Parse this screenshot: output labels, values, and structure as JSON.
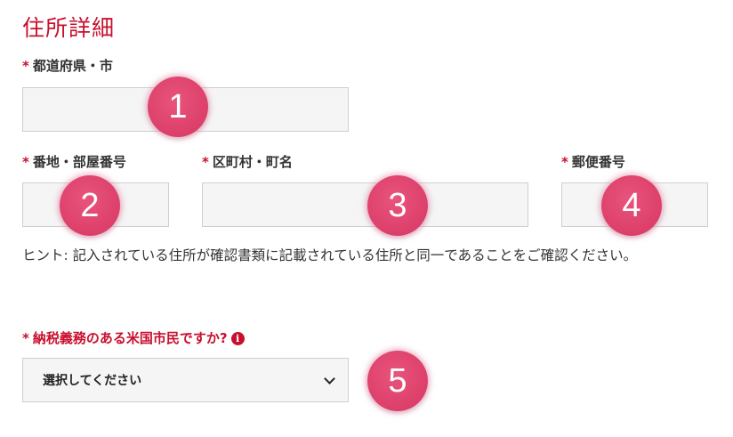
{
  "section_title": "住所詳細",
  "required_mark": "*",
  "fields": {
    "prefecture_city": {
      "label": "都道府県・市",
      "value": ""
    },
    "street_room": {
      "label": "番地・部屋番号",
      "value": ""
    },
    "ward_town": {
      "label": "区町村・町名",
      "value": ""
    },
    "postal_code": {
      "label": "郵便番号",
      "value": ""
    }
  },
  "hint": "ヒント: 記入されている住所が確認書類に記載されている住所と同一であることをご確認ください。",
  "tax_question": {
    "label": "納税義務のある米国市民ですか?",
    "info_icon": "i",
    "selected": "選択してください"
  },
  "badges": [
    "1",
    "2",
    "3",
    "4",
    "5"
  ],
  "colors": {
    "accent_red": "#c8102e",
    "badge_pink": "#dc3f6a",
    "field_bg": "#f5f5f5",
    "field_border": "#cfcfcf"
  }
}
